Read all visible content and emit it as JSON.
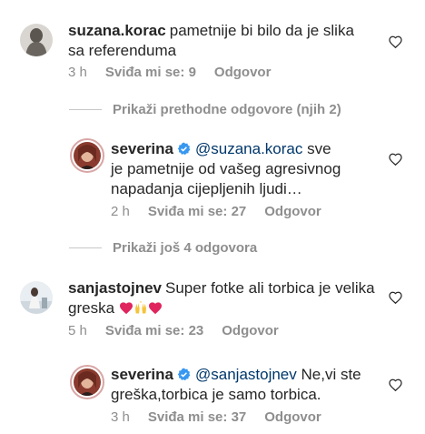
{
  "comments": [
    {
      "username": "suzana.korac",
      "text_line1": "pametnije bi bilo da je slika",
      "text_line2": "sa referenduma",
      "time": "3 h",
      "likes": "Sviđa mi se: 9",
      "reply": "Odgovor"
    },
    {
      "username": "severina",
      "mention": "@suzana.korac",
      "text_after_mention": " sve",
      "text_line2": "je pametnije od vašeg agresivnog",
      "text_line3": "napadanja cijepljenih ljudi…",
      "time": "2 h",
      "likes": "Sviđa mi se: 27",
      "reply": "Odgovor"
    },
    {
      "username": "sanjastojnev",
      "text_line1": "Super fotke ali torbica je velika",
      "text_line2": "greska",
      "emoji": [
        "red-heart",
        "raising-hands",
        "red-heart"
      ],
      "time": "5 h",
      "likes": "Sviđa mi se: 23",
      "reply": "Odgovor"
    },
    {
      "username": "severina",
      "mention": "@sanjastojnev",
      "text_after_mention": " Ne,vi ste",
      "text_line2": "greška,torbica je samo torbica.",
      "time": "3 h",
      "likes": "Sviđa mi se: 37",
      "reply": "Odgovor"
    }
  ],
  "toggles": {
    "previous_replies": "Prikaži prethodne odgovore (njih 2)",
    "more_replies": "Prikaži još 4 odgovora"
  },
  "colors": {
    "text": "#262626",
    "meta": "#8e8e8e",
    "mention": "#00376b",
    "verified": "#3897f0",
    "heart_emoji": "#e0245e"
  },
  "icons": {
    "like": "heart-outline-icon",
    "verified": "verified-badge-icon"
  }
}
